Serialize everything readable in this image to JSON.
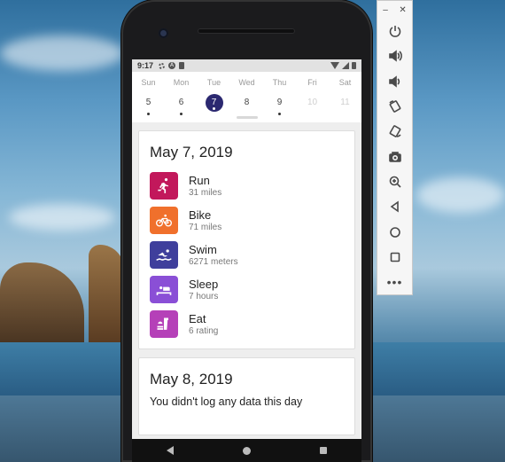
{
  "status_bar": {
    "time": "9:17"
  },
  "week": {
    "days": [
      {
        "name": "Sun",
        "num": "5",
        "state": "dot"
      },
      {
        "name": "Mon",
        "num": "6",
        "state": "dot"
      },
      {
        "name": "Tue",
        "num": "7",
        "state": "selected"
      },
      {
        "name": "Wed",
        "num": "8",
        "state": "plain"
      },
      {
        "name": "Thu",
        "num": "9",
        "state": "dot"
      },
      {
        "name": "Fri",
        "num": "10",
        "state": "future"
      },
      {
        "name": "Sat",
        "num": "11",
        "state": "future"
      }
    ]
  },
  "cards": {
    "day1": {
      "date": "May 7, 2019",
      "activities": [
        {
          "label": "Run",
          "detail": "31 miles",
          "color": "#c2185b",
          "icon": "run-icon"
        },
        {
          "label": "Bike",
          "detail": "71 miles",
          "color": "#f0702c",
          "icon": "bike-icon"
        },
        {
          "label": "Swim",
          "detail": "6271 meters",
          "color": "#3f3f9c",
          "icon": "swim-icon"
        },
        {
          "label": "Sleep",
          "detail": "7 hours",
          "color": "#8a4fd6",
          "icon": "bed-icon"
        },
        {
          "label": "Eat",
          "detail": "6 rating",
          "color": "#b540b8",
          "icon": "food-icon"
        }
      ]
    },
    "day2": {
      "date": "May 8, 2019",
      "message": "You didn't log any data this day"
    }
  },
  "emulator_toolbar": {
    "buttons": [
      "power-icon",
      "volume-up-icon",
      "volume-down-icon",
      "rotate-left-icon",
      "rotate-right-icon",
      "camera-icon",
      "zoom-icon",
      "back-icon",
      "home-icon",
      "overview-icon",
      "more-icon"
    ]
  }
}
